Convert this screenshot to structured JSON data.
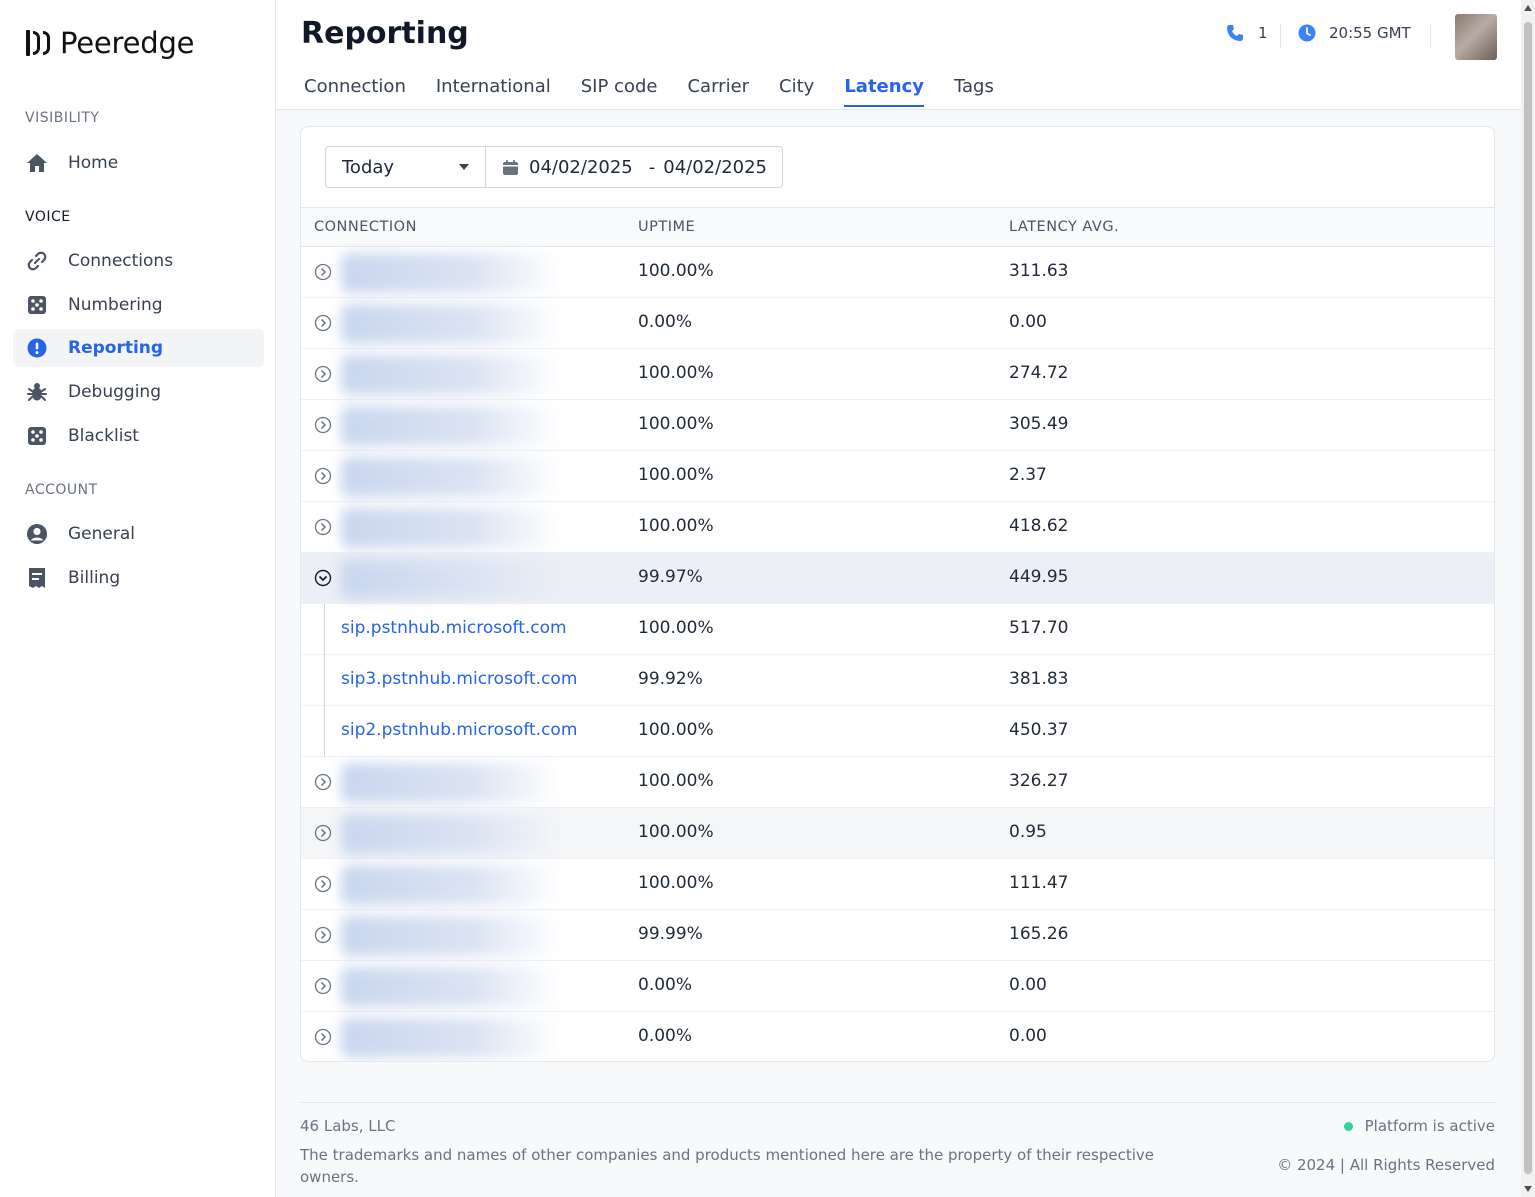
{
  "brand": {
    "name": "Peeredge"
  },
  "sidebar": {
    "sections": [
      {
        "label": "VISIBILITY",
        "items": [
          {
            "label": "Home",
            "icon": "home-icon"
          }
        ]
      },
      {
        "label": "VOICE",
        "items": [
          {
            "label": "Connections",
            "icon": "link-icon"
          },
          {
            "label": "Numbering",
            "icon": "dice-icon"
          },
          {
            "label": "Reporting",
            "icon": "alert-circle-icon",
            "active": true
          },
          {
            "label": "Debugging",
            "icon": "bug-icon"
          },
          {
            "label": "Blacklist",
            "icon": "dice-icon"
          }
        ]
      },
      {
        "label": "ACCOUNT",
        "items": [
          {
            "label": "General",
            "icon": "user-circle-icon"
          },
          {
            "label": "Billing",
            "icon": "receipt-icon"
          }
        ]
      }
    ]
  },
  "header": {
    "title": "Reporting",
    "calls": "1",
    "time": "20:55 GMT",
    "tabs": [
      "Connection",
      "International",
      "SIP code",
      "Carrier",
      "City",
      "Latency",
      "Tags"
    ],
    "active_tab": "Latency"
  },
  "filter": {
    "period": "Today",
    "date_from": "04/02/2025",
    "date_separator": "-",
    "date_to": "04/02/2025"
  },
  "table": {
    "columns": [
      "CONNECTION",
      "UPTIME",
      "LATENCY AVG."
    ],
    "rows": [
      {
        "uptime": "100.00%",
        "latency": "311.63"
      },
      {
        "uptime": "0.00%",
        "latency": "0.00"
      },
      {
        "uptime": "100.00%",
        "latency": "274.72"
      },
      {
        "uptime": "100.00%",
        "latency": "305.49"
      },
      {
        "uptime": "100.00%",
        "latency": "2.37"
      },
      {
        "uptime": "100.00%",
        "latency": "418.62"
      },
      {
        "uptime": "99.97%",
        "latency": "449.95",
        "expanded": true,
        "children": [
          {
            "host": "sip.pstnhub.microsoft.com",
            "uptime": "100.00%",
            "latency": "517.70"
          },
          {
            "host": "sip3.pstnhub.microsoft.com",
            "uptime": "99.92%",
            "latency": "381.83"
          },
          {
            "host": "sip2.pstnhub.microsoft.com",
            "uptime": "100.00%",
            "latency": "450.37"
          }
        ]
      },
      {
        "uptime": "100.00%",
        "latency": "326.27"
      },
      {
        "uptime": "100.00%",
        "latency": "0.95"
      },
      {
        "uptime": "100.00%",
        "latency": "111.47"
      },
      {
        "uptime": "99.99%",
        "latency": "165.26"
      },
      {
        "uptime": "0.00%",
        "latency": "0.00"
      },
      {
        "uptime": "0.00%",
        "latency": "0.00"
      }
    ]
  },
  "footer": {
    "company": "46 Labs, LLC",
    "disclaimer": "The trademarks and names of other companies and products mentioned here are the property of their respective owners.",
    "status": "Platform is active",
    "copyright": "© 2024 | All Rights Reserved"
  },
  "colors": {
    "accent": "#2563eb",
    "status_ok": "#34d399"
  }
}
